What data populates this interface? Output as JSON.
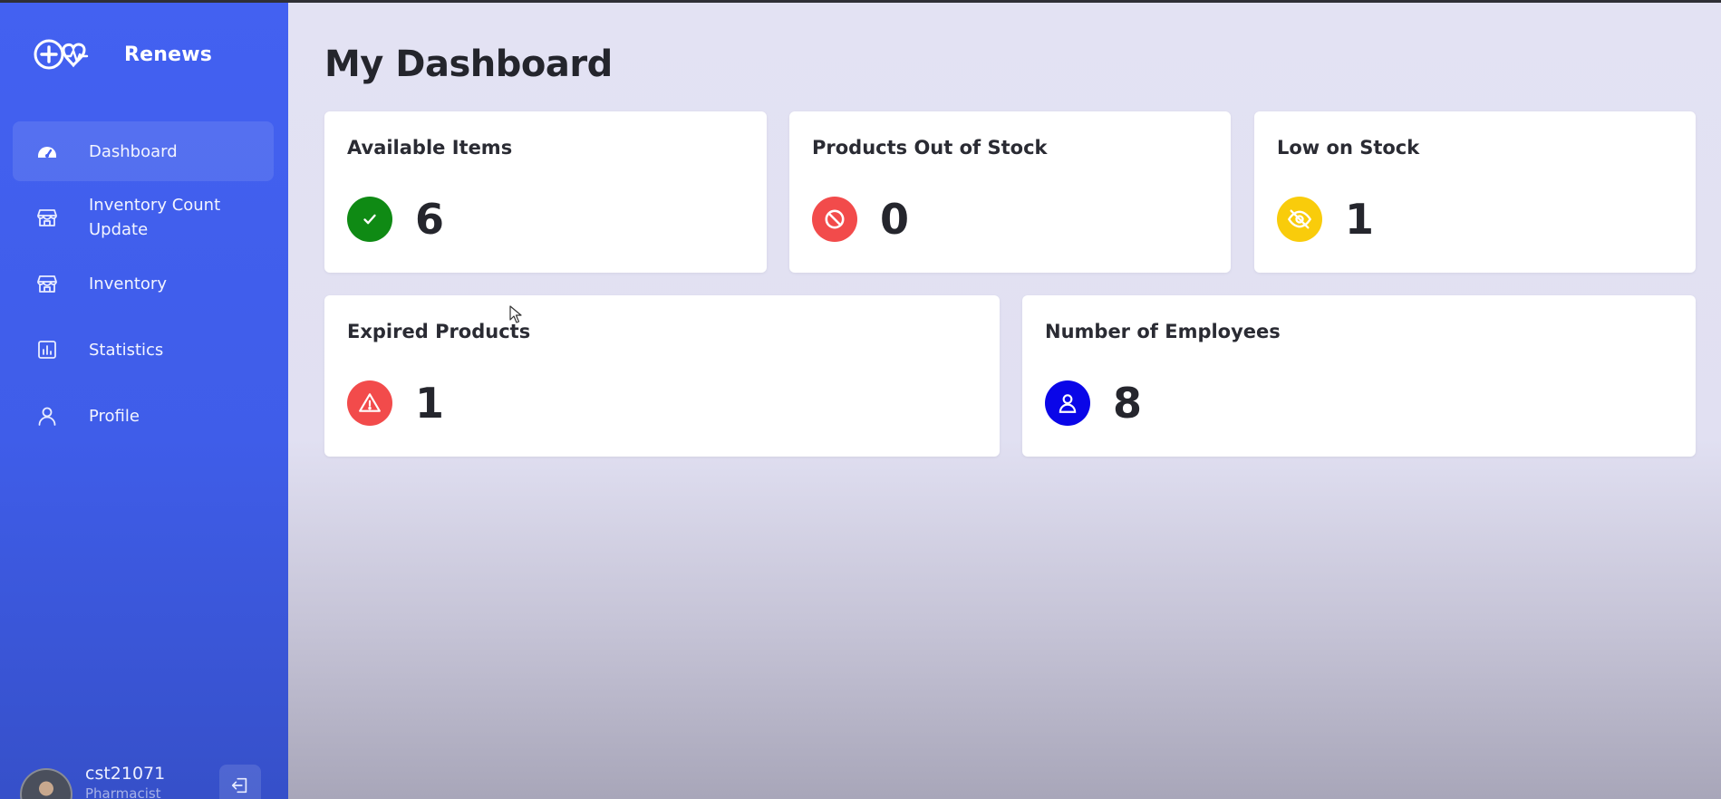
{
  "brand": {
    "name": "Renews",
    "logo_icon": "medical-heartbeat-icon"
  },
  "sidebar": {
    "items": [
      {
        "label": "Dashboard",
        "icon": "speedometer-icon",
        "active": true
      },
      {
        "label": "Inventory Count Update",
        "icon": "store-icon",
        "active": false
      },
      {
        "label": "Inventory",
        "icon": "store-icon",
        "active": false
      },
      {
        "label": "Statistics",
        "icon": "bar-chart-icon",
        "active": false
      },
      {
        "label": "Profile",
        "icon": "user-icon",
        "active": false
      }
    ]
  },
  "user": {
    "name": "cst21071",
    "role": "Pharmacist"
  },
  "main": {
    "title": "My Dashboard",
    "cards": [
      {
        "title": "Available Items",
        "value": "6",
        "icon": "check-icon",
        "color": "#0f8a14"
      },
      {
        "title": "Products Out of Stock",
        "value": "0",
        "icon": "ban-icon",
        "color": "#f24b4b"
      },
      {
        "title": "Low on Stock",
        "value": "1",
        "icon": "eye-off-icon",
        "color": "#f9cc0b"
      },
      {
        "title": "Expired Products",
        "value": "1",
        "icon": "warning-icon",
        "color": "#f24b4b"
      },
      {
        "title": "Number of Employees",
        "value": "8",
        "icon": "user-icon",
        "color": "#0a06e8"
      }
    ]
  }
}
